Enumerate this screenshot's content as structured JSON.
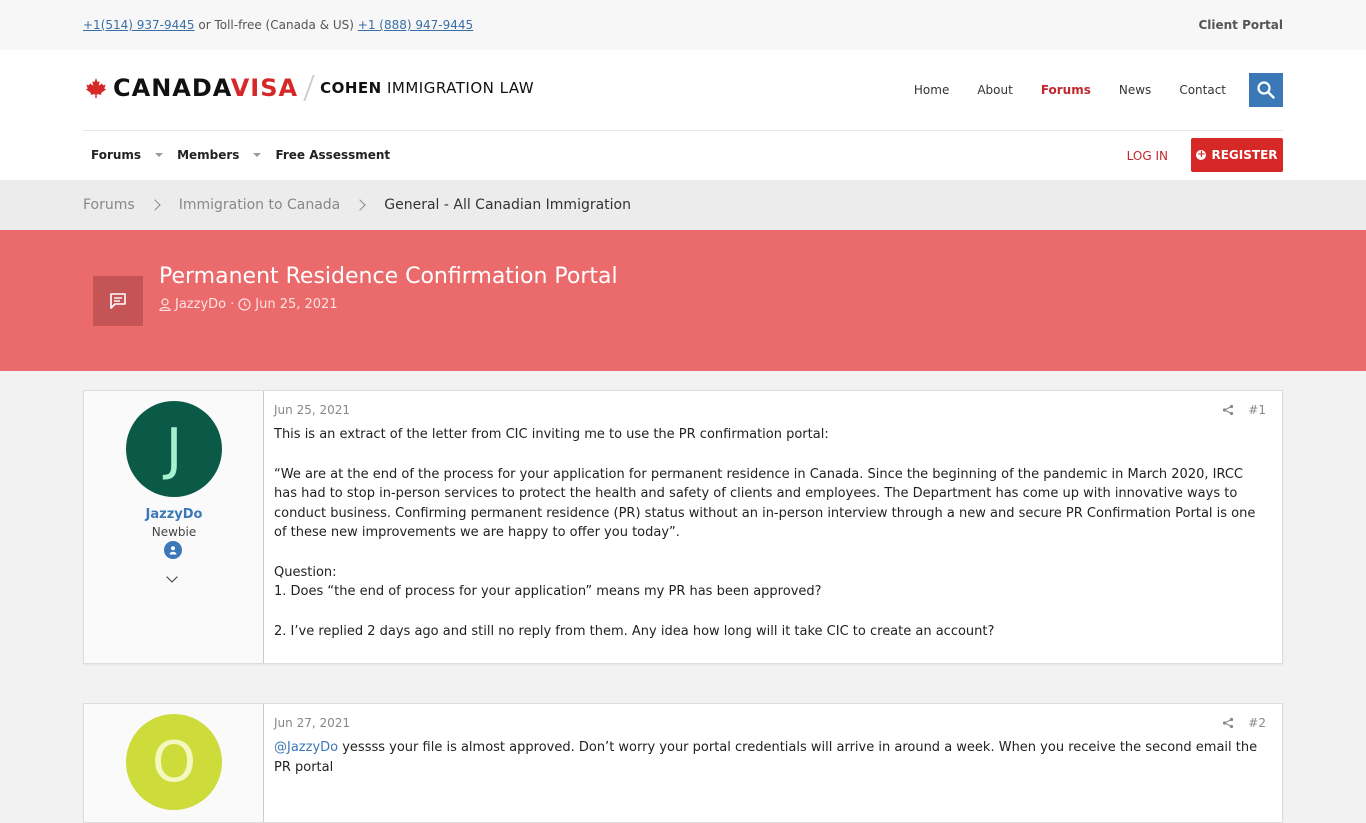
{
  "topbar": {
    "phone1": "+1(514) 937-9445",
    "connector": " or Toll-free (Canada & US) ",
    "phone2": "+1 (888) 947-9445",
    "client_portal": "Client Portal"
  },
  "logo": {
    "brand_a": "CANADA",
    "brand_b": "VISA",
    "cohen_bold": "COHEN",
    "cohen_rest": " IMMIGRATION LAW"
  },
  "mainnav": {
    "items": [
      "Home",
      "About",
      "Forums",
      "News",
      "Contact"
    ],
    "active": "Forums"
  },
  "subnav": {
    "forums": "Forums",
    "members": "Members",
    "free_assessment": "Free Assessment",
    "login": "LOG IN",
    "register": "REGISTER"
  },
  "breadcrumb": [
    "Forums",
    "Immigration to Canada",
    "General - All Canadian Immigration"
  ],
  "thread": {
    "title": "Permanent Residence Confirmation Portal",
    "author": "JazzyDo",
    "date": "Jun 25, 2021",
    "separator": "·"
  },
  "posts": [
    {
      "avatar_letter": "J",
      "avatar_bg": "#0b5a47",
      "avatar_fg": "#a8f0d2",
      "username": "JazzyDo",
      "usertitle": "Newbie",
      "date": "Jun 25, 2021",
      "number": "#1",
      "paragraphs": [
        "This is an extract of the letter from CIC inviting me to use the PR confirmation portal:",
        "“We are at the end of the process for your application for permanent residence in Canada. Since the beginning of the pandemic in March 2020, IRCC has had to stop in-person services to protect the health and safety of clients and employees. The Department has come up with innovative ways to conduct business. Confirming permanent residence (PR) status without an in-person interview through a new and secure PR Confirmation Portal is one of these new improvements we are happy to offer you today”.",
        "Question:\n1. Does “the end of process for your application” means my PR has been approved?",
        "2. I’ve replied 2 days ago and still no reply from them. Any idea how long will it take CIC to create an account?"
      ]
    },
    {
      "avatar_letter": "O",
      "avatar_bg": "#cddc3a",
      "avatar_fg": "#f3f8bf",
      "date": "Jun 27, 2021",
      "number": "#2",
      "mention": "@JazzyDo",
      "text": " yessss your file is almost approved. Don’t worry your portal credentials will arrive in around a week. When you receive the second email the PR portal"
    }
  ],
  "colors": {
    "accent_red": "#d72828",
    "banner": "#eb6a6c",
    "link_blue": "#3b78b7"
  }
}
